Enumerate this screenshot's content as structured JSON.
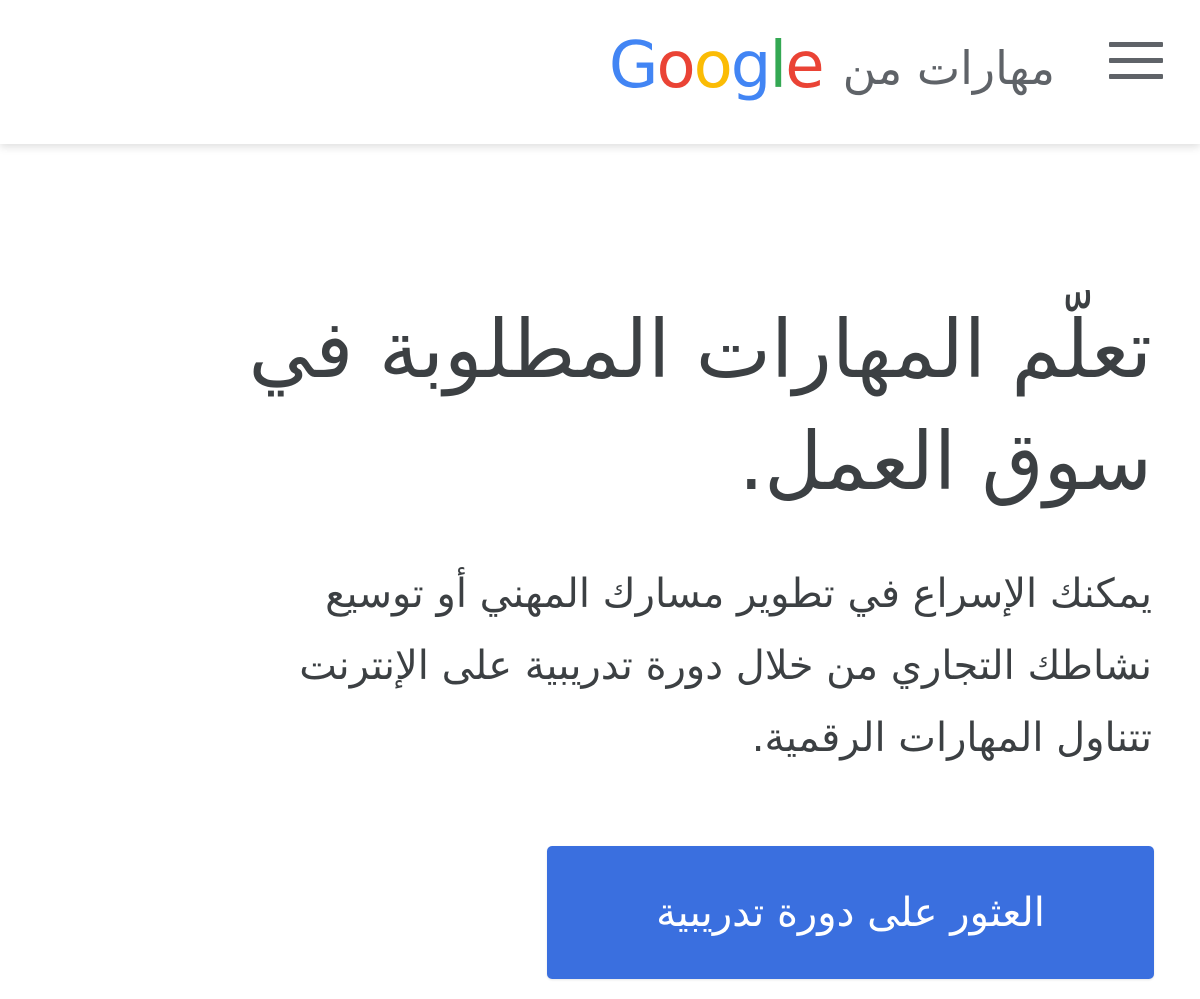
{
  "header": {
    "menu_icon": "hamburger-menu-icon",
    "brand_text": "مهارات من",
    "logo": {
      "letters": [
        "G",
        "o",
        "o",
        "g",
        "l",
        "e"
      ],
      "colors": [
        "#4285F4",
        "#EA4335",
        "#FBBC05",
        "#4285F4",
        "#34A853",
        "#EA4335"
      ]
    }
  },
  "main": {
    "heading_line1": "تعلّم المهارات المطلوبة في",
    "heading_line2": "سوق العمل.",
    "description_line1": "يمكنك الإسراع في تطوير مسارك المهني أو توسيع",
    "description_line2": "نشاطك التجاري من خلال دورة تدريبية على الإنترنت",
    "description_line3": "تتناول المهارات الرقمية.",
    "cta_label": "العثور على دورة تدريبية"
  },
  "colors": {
    "button": "#3a6fdf",
    "text": "#3c4043",
    "icon": "#5f6368"
  }
}
